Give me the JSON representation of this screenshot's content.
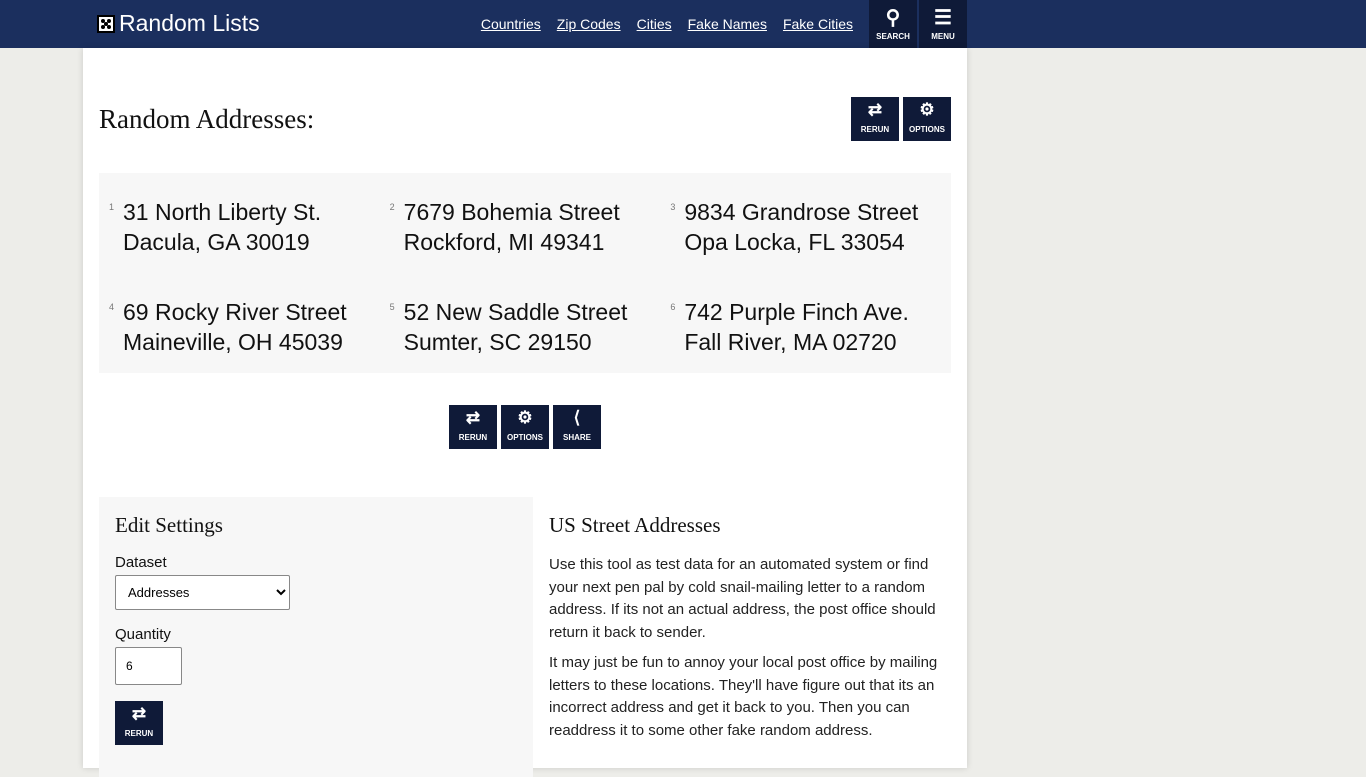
{
  "nav": {
    "logo": "Random Lists",
    "links": [
      "Countries",
      "Zip Codes",
      "Cities",
      "Fake Names",
      "Fake Cities"
    ],
    "search": "SEARCH",
    "menu": "MENU"
  },
  "page": {
    "title": "Random Addresses:",
    "rerun": "RERUN",
    "options": "OPTIONS",
    "share": "SHARE"
  },
  "addresses": [
    {
      "n": "1",
      "l1": "31 North Liberty St.",
      "l2": "Dacula, GA 30019"
    },
    {
      "n": "2",
      "l1": "7679 Bohemia Street",
      "l2": "Rockford, MI 49341"
    },
    {
      "n": "3",
      "l1": "9834 Grandrose Street",
      "l2": "Opa Locka, FL 33054"
    },
    {
      "n": "4",
      "l1": "69 Rocky River Street",
      "l2": "Maineville, OH 45039"
    },
    {
      "n": "5",
      "l1": "52 New Saddle Street",
      "l2": "Sumter, SC 29150"
    },
    {
      "n": "6",
      "l1": "742 Purple Finch Ave.",
      "l2": "Fall River, MA 02720"
    }
  ],
  "settings": {
    "title": "Edit Settings",
    "dataset_label": "Dataset",
    "dataset_value": "Addresses",
    "quantity_label": "Quantity",
    "quantity_value": "6",
    "rerun": "RERUN"
  },
  "info": {
    "title": "US Street Addresses",
    "p1": "Use this tool as test data for an automated system or find your next pen pal by cold snail-mailing letter to a random address. If its not an actual address, the post office should return it back to sender.",
    "p2": "It may just be fun to annoy your local post office by mailing letters to these locations. They'll have figure out that its an incorrect address and get it back to you. Then you can readdress it to some other fake random address."
  }
}
